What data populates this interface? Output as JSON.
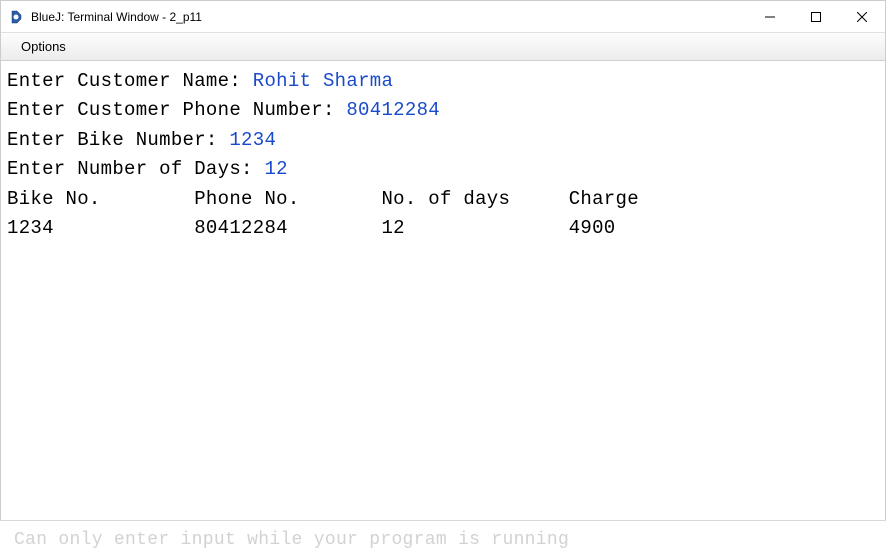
{
  "window": {
    "title": "BlueJ: Terminal Window - 2_p11"
  },
  "menubar": {
    "options_label": "Options"
  },
  "terminal": {
    "lines": [
      {
        "prompt": "Enter Customer Name: ",
        "input": "Rohit Sharma"
      },
      {
        "prompt": "Enter Customer Phone Number: ",
        "input": "80412284"
      },
      {
        "prompt": "Enter Bike Number: ",
        "input": "1234"
      },
      {
        "prompt": "Enter Number of Days: ",
        "input": "12"
      }
    ],
    "header_row": {
      "bike_no": "Bike No.",
      "phone_no": "Phone No.",
      "days": "No. of days",
      "charge": "Charge"
    },
    "data_row": {
      "bike_no": "1234",
      "phone_no": "80412284",
      "days": "12",
      "charge": "4900"
    }
  },
  "input_area": {
    "placeholder": "Can only enter input while your program is running"
  }
}
